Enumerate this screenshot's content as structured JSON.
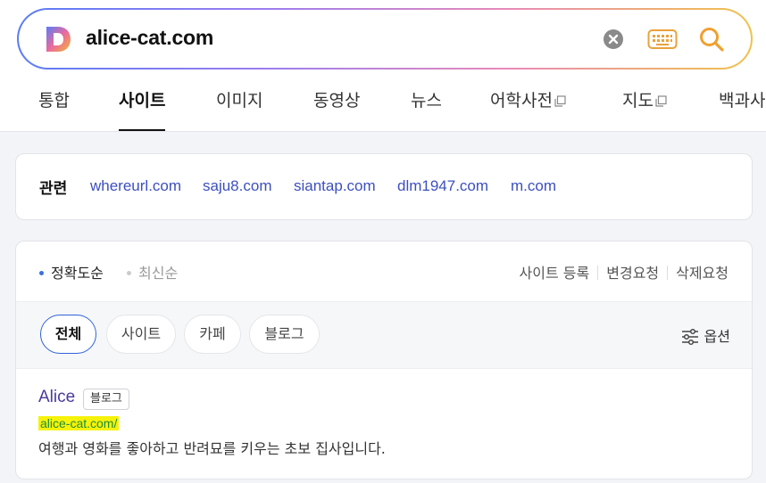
{
  "search": {
    "query": "alice-cat.com"
  },
  "tabs": [
    {
      "label": "통합",
      "active": false,
      "external": false
    },
    {
      "label": "사이트",
      "active": true,
      "external": false
    },
    {
      "label": "이미지",
      "active": false,
      "external": false
    },
    {
      "label": "동영상",
      "active": false,
      "external": false
    },
    {
      "label": "뉴스",
      "active": false,
      "external": false
    },
    {
      "label": "어학사전",
      "active": false,
      "external": true
    },
    {
      "label": "지도",
      "active": false,
      "external": true
    },
    {
      "label": "백과사전",
      "active": false,
      "external": false
    }
  ],
  "related": {
    "label": "관련",
    "links": [
      "whereurl.com",
      "saju8.com",
      "siantap.com",
      "dlm1947.com",
      "m.com"
    ]
  },
  "sort": {
    "accuracy": "정확도순",
    "latest": "최신순"
  },
  "site_actions": [
    "사이트 등록",
    "변경요청",
    "삭제요청"
  ],
  "filters": [
    "전체",
    "사이트",
    "카페",
    "블로그"
  ],
  "options_label": "옵션",
  "result": {
    "title": "Alice",
    "badge": "블로그",
    "url": "alice-cat.com/",
    "description": "여행과 영화를 좋아하고 반려묘를 키우는 초보 집사입니다."
  },
  "colors": {
    "link": "#3c4fbf",
    "result_title": "#4b3a9c",
    "url_green": "#1e8e3e",
    "url_highlight": "#f6f20a",
    "active_accent": "#2e62d9"
  },
  "icons": {
    "logo": "daum-d-logo",
    "clear": "clear-icon",
    "keyboard": "keyboard-icon",
    "search": "search-icon",
    "options": "sliders-icon",
    "external": "external-window-icon"
  }
}
